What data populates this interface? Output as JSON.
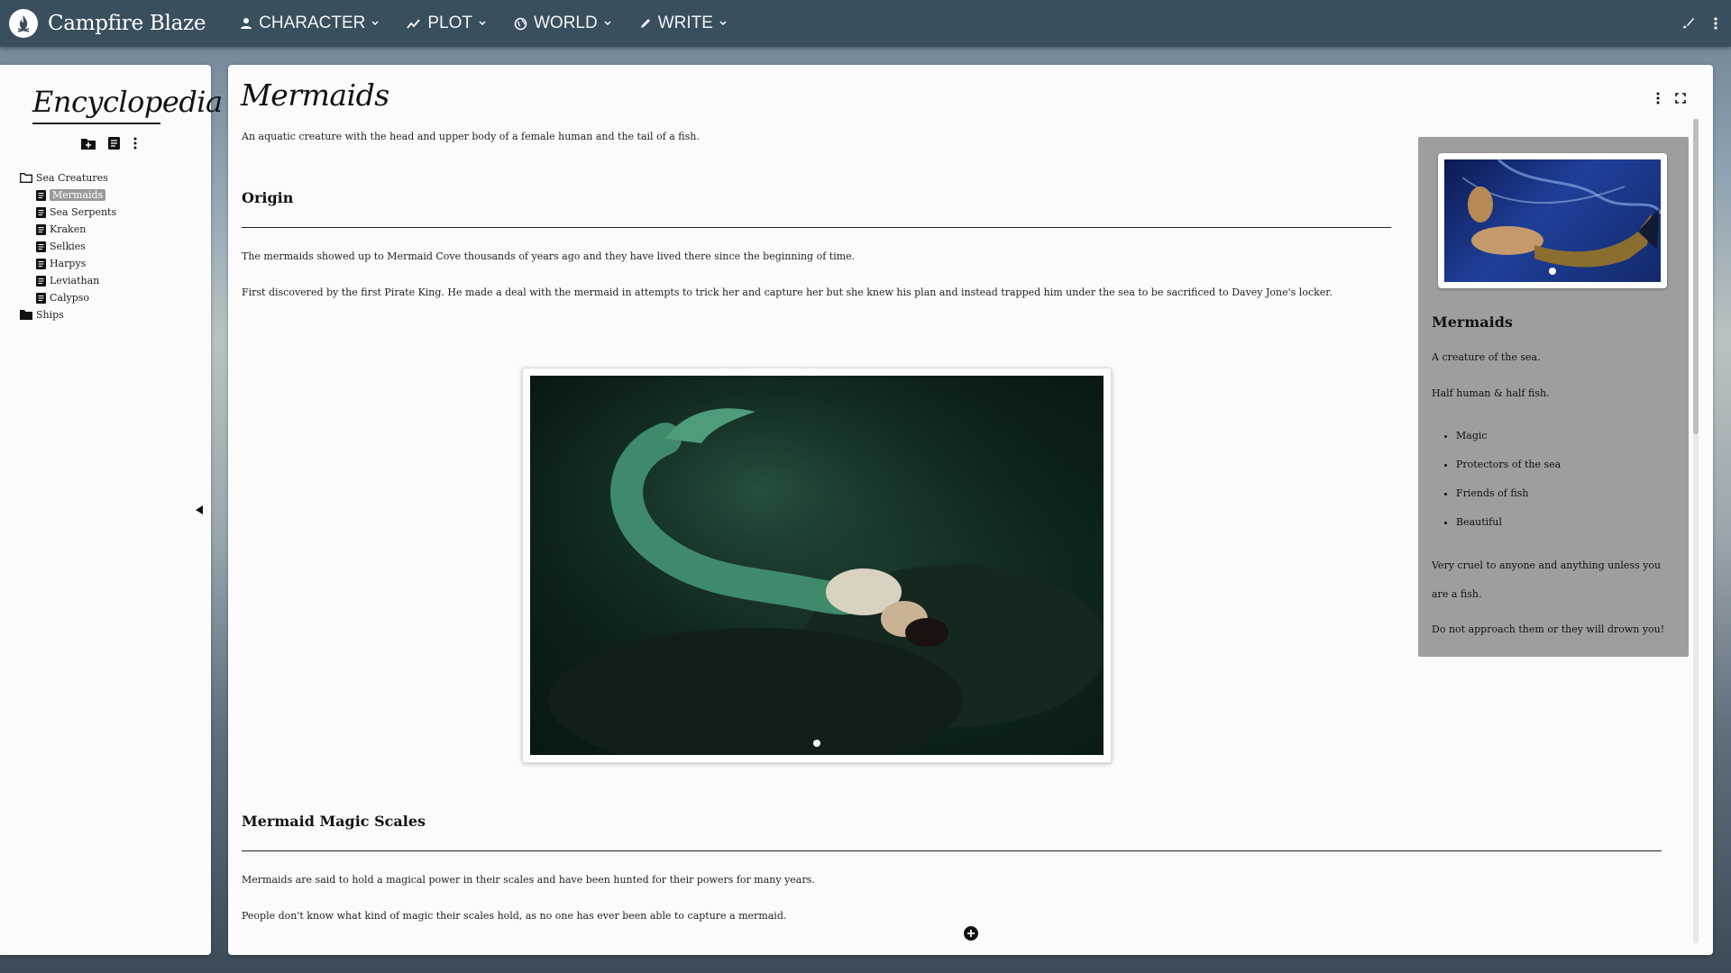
{
  "app": {
    "name": "Campfire Blaze",
    "logo_icon": "campfire-flame-icon"
  },
  "nav": [
    {
      "label": "CHARACTER",
      "icon": "person-icon"
    },
    {
      "label": "PLOT",
      "icon": "trend-chart-icon"
    },
    {
      "label": "WORLD",
      "icon": "globe-icon"
    },
    {
      "label": "WRITE",
      "icon": "pencil-icon"
    }
  ],
  "sidebar": {
    "title": "Encyclopedia",
    "tree": {
      "folder_1": "Sea Creatures",
      "items": [
        "Mermaids",
        "Sea Serpents",
        "Kraken",
        "Selkies",
        "Harpys",
        "Leviathan",
        "Calypso"
      ],
      "selected": "Mermaids",
      "folder_2": "Ships"
    }
  },
  "article": {
    "title": "Mermaids",
    "description": "An aquatic creature with the head and upper body of a female human and the tail of a fish.",
    "origin": {
      "heading": "Origin",
      "p1": "The mermaids showed up to Mermaid Cove thousands of years ago and they have lived there since the beginning of time.",
      "p2": "First discovered by the first Pirate King. He made a deal with the mermaid in attempts to trick her and capture her but she knew his plan and instead trapped him under the sea to be sacrificed to Davey Jone's locker."
    },
    "magic": {
      "heading": "Mermaid Magic Scales",
      "p1": "Mermaids are said to hold a magical power in their scales and have been hunted for their powers for many years.",
      "p2": "People don't know what kind of magic their scales hold, as no one has ever been able to capture a mermaid."
    }
  },
  "infobox": {
    "title": "Mermaids",
    "p1": "A creature of the sea.",
    "p2": "Half human & half fish.",
    "traits": [
      "Magic",
      "Protectors of the sea",
      "Friends of fish",
      "Beautiful"
    ],
    "p3": "Very cruel to anyone and anything unless you are a fish.",
    "p4": "Do not approach them or they will drown you!"
  },
  "colors": {
    "topbar": "#3a4f5d",
    "panel": "#fbfbfb",
    "infobox": "#9e9e9e",
    "selected_item": "#9a9a9a"
  }
}
